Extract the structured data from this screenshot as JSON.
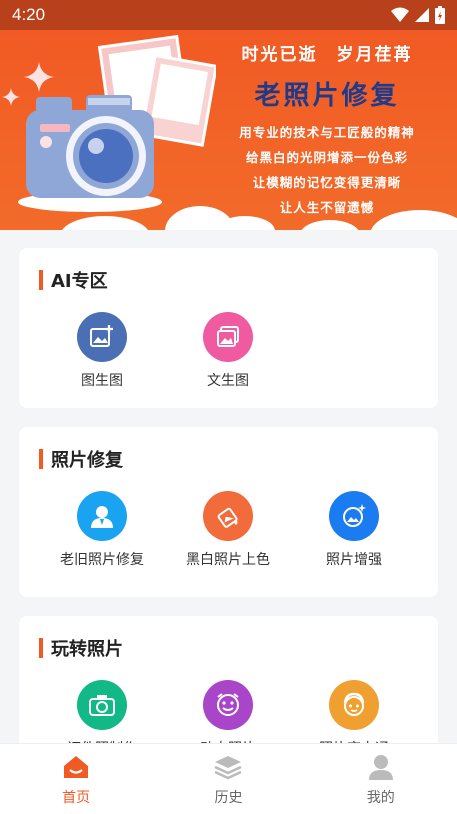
{
  "status_bar": {
    "time": "4:20"
  },
  "banner": {
    "slogan": "时光已逝　岁月荏苒",
    "title": "老照片修复",
    "lines": [
      "用专业的技术与工匠般的精神",
      "给黑白的光阴增添一份色彩",
      "让模糊的记忆变得更清晰",
      "让人生不留遗憾"
    ]
  },
  "sections": [
    {
      "title": "AI专区",
      "items": [
        {
          "label": "图生图",
          "icon": "image-add-icon",
          "color": "#4a6fb5"
        },
        {
          "label": "文生图",
          "icon": "images-icon",
          "color": "#f05aa0"
        }
      ]
    },
    {
      "title": "照片修复",
      "items": [
        {
          "label": "老旧照片修复",
          "icon": "person-icon",
          "color": "#1aa3f0"
        },
        {
          "label": "黑白照片上色",
          "icon": "paint-bucket-icon",
          "color": "#f26b3a"
        },
        {
          "label": "照片增强",
          "icon": "photo-enhance-icon",
          "color": "#1a7cf0"
        }
      ]
    },
    {
      "title": "玩转照片",
      "items": [
        {
          "label": "证件照制作",
          "icon": "camera-icon",
          "color": "#12b886"
        },
        {
          "label": "动态照片",
          "icon": "face-icon",
          "color": "#a945c9"
        },
        {
          "label": "照片变卡通",
          "icon": "cartoon-face-icon",
          "color": "#f0a030"
        }
      ]
    }
  ],
  "bottom_nav": [
    {
      "label": "首页",
      "icon": "home-icon",
      "active": true
    },
    {
      "label": "历史",
      "icon": "layers-icon",
      "active": false
    },
    {
      "label": "我的",
      "icon": "user-icon",
      "active": false
    }
  ],
  "colors": {
    "accent": "#f05a24",
    "banner": "#f15a24",
    "status_bar": "#b8401a"
  }
}
